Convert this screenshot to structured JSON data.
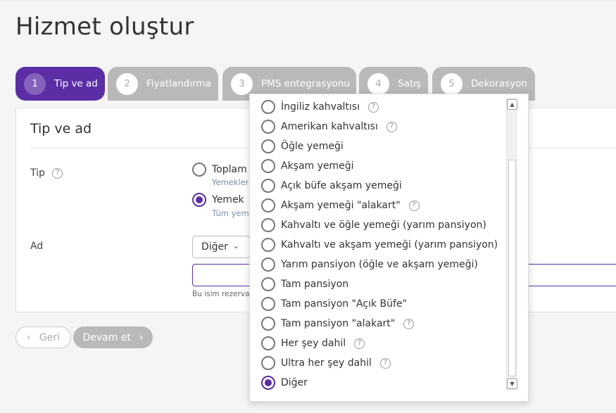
{
  "page": {
    "title": "Hizmet oluştur"
  },
  "steps": [
    {
      "num": "1",
      "label": "Tip ve ad",
      "active": true
    },
    {
      "num": "2",
      "label": "Fiyatlandırma",
      "active": false
    },
    {
      "num": "3",
      "label": "PMS entegrasyonu",
      "active": false
    },
    {
      "num": "4",
      "label": "Satış",
      "active": false
    },
    {
      "num": "5",
      "label": "Dekorasyon",
      "active": false
    }
  ],
  "card": {
    "title": "Tip ve ad",
    "type_label": "Tip",
    "type_help": "?",
    "options": [
      {
        "label": "Toplam",
        "sub": "Yemekler",
        "checked": false
      },
      {
        "label": "Yemek",
        "sub": "Tüm yeme",
        "checked": true
      }
    ],
    "name_label": "Ad",
    "select_value": "Diğer",
    "select_chevron": "⌄",
    "hint": "Bu isim rezervasy"
  },
  "footer": {
    "back_label": "Geri",
    "back_icon": "‹",
    "next_label": "Devam et",
    "next_icon": "›"
  },
  "dropdown": {
    "scroll_up": "▲",
    "scroll_down": "▼",
    "items": [
      {
        "label": "İngiliz kahvaltısı",
        "help": "?",
        "checked": false
      },
      {
        "label": "Amerikan kahvaltısı",
        "help": "?",
        "checked": false
      },
      {
        "label": "Öğle yemeği",
        "help": "",
        "checked": false
      },
      {
        "label": "Akşam yemeği",
        "help": "",
        "checked": false
      },
      {
        "label": "Açık büfe akşam yemeği",
        "help": "",
        "checked": false
      },
      {
        "label": "Akşam yemeği \"alakart\"",
        "help": "?",
        "checked": false
      },
      {
        "label": "Kahvaltı ve öğle yemeği (yarım pansiyon)",
        "help": "",
        "checked": false
      },
      {
        "label": "Kahvaltı ve akşam yemeği (yarım pansiyon)",
        "help": "",
        "checked": false
      },
      {
        "label": "Yarım pansiyon (öğle ve akşam yemeği)",
        "help": "",
        "checked": false
      },
      {
        "label": "Tam pansiyon",
        "help": "",
        "checked": false
      },
      {
        "label": "Tam pansiyon \"Açık Büfe\"",
        "help": "",
        "checked": false
      },
      {
        "label": "Tam pansiyon \"alakart\"",
        "help": "?",
        "checked": false
      },
      {
        "label": "Her şey dahil",
        "help": "?",
        "checked": false
      },
      {
        "label": "Ultra her şey dahil",
        "help": "?",
        "checked": false
      },
      {
        "label": "Diğer",
        "help": "",
        "checked": true
      }
    ]
  },
  "colors": {
    "accent": "#5b2ea6",
    "inactive_step": "#b9b9b9",
    "sub_text": "#7c8ea8"
  }
}
